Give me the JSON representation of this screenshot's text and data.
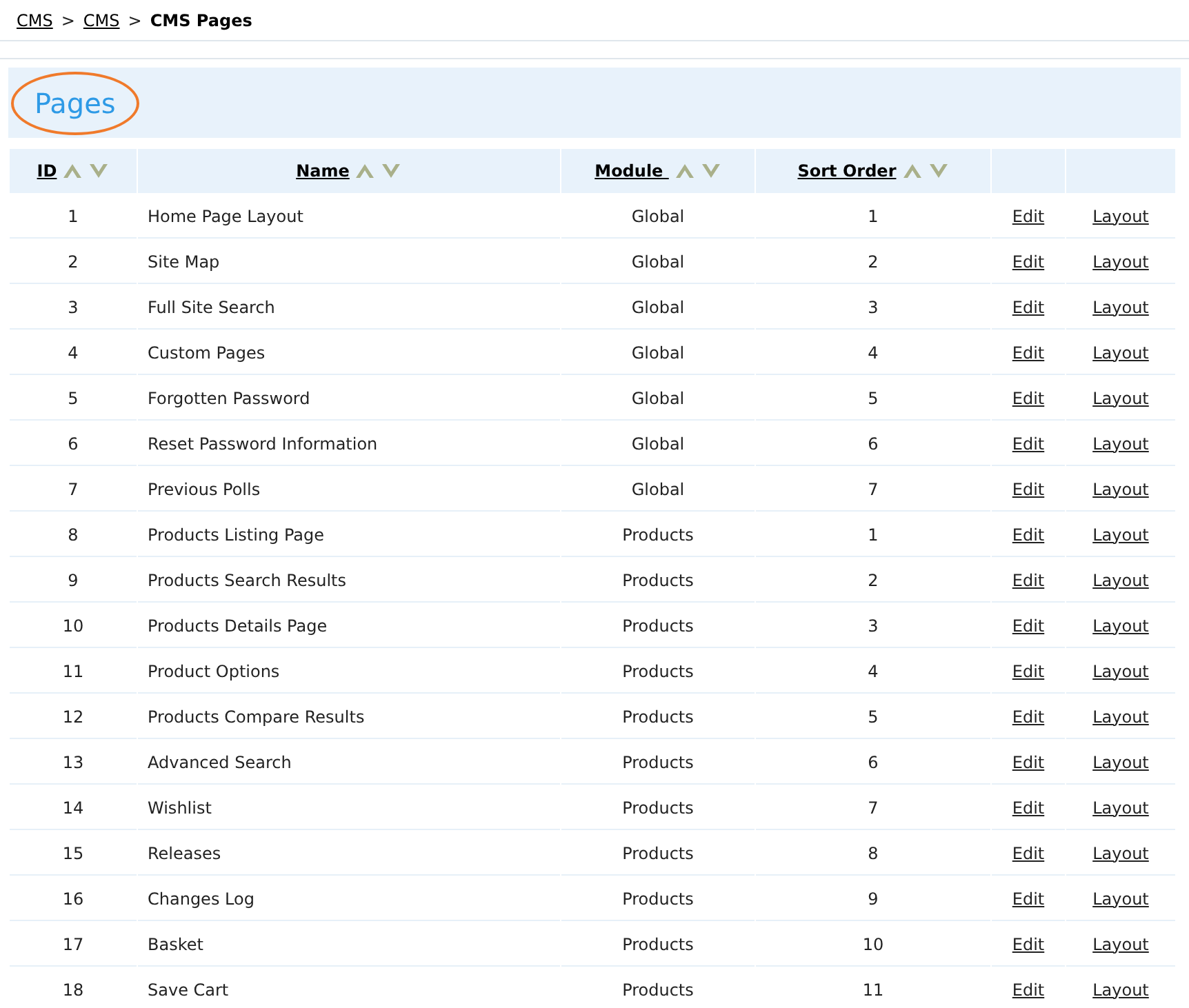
{
  "breadcrumb": {
    "links": [
      "CMS",
      "CMS"
    ],
    "separators": [
      ">",
      ">"
    ],
    "current": "CMS Pages"
  },
  "panel": {
    "title": "Pages",
    "circled": true
  },
  "table": {
    "columns": [
      {
        "label": "ID",
        "sortable": true
      },
      {
        "label": "Name",
        "sortable": true
      },
      {
        "label": "Module ",
        "sortable": true
      },
      {
        "label": "Sort Order",
        "sortable": true
      }
    ],
    "rows": [
      {
        "id": "1",
        "name": "Home Page Layout",
        "module": "Global",
        "sort_order": "1",
        "edit": "Edit",
        "layout": "Layout"
      },
      {
        "id": "2",
        "name": "Site Map",
        "module": "Global",
        "sort_order": "2",
        "edit": "Edit",
        "layout": "Layout"
      },
      {
        "id": "3",
        "name": "Full Site Search",
        "module": "Global",
        "sort_order": "3",
        "edit": "Edit",
        "layout": "Layout"
      },
      {
        "id": "4",
        "name": "Custom Pages",
        "module": "Global",
        "sort_order": "4",
        "edit": "Edit",
        "layout": "Layout"
      },
      {
        "id": "5",
        "name": "Forgotten Password",
        "module": "Global",
        "sort_order": "5",
        "edit": "Edit",
        "layout": "Layout"
      },
      {
        "id": "6",
        "name": "Reset Password Information",
        "module": "Global",
        "sort_order": "6",
        "edit": "Edit",
        "layout": "Layout"
      },
      {
        "id": "7",
        "name": "Previous Polls",
        "module": "Global",
        "sort_order": "7",
        "edit": "Edit",
        "layout": "Layout"
      },
      {
        "id": "8",
        "name": "Products Listing Page",
        "module": "Products",
        "sort_order": "1",
        "edit": "Edit",
        "layout": "Layout"
      },
      {
        "id": "9",
        "name": "Products Search Results",
        "module": "Products",
        "sort_order": "2",
        "edit": "Edit",
        "layout": "Layout"
      },
      {
        "id": "10",
        "name": "Products Details Page",
        "module": "Products",
        "sort_order": "3",
        "edit": "Edit",
        "layout": "Layout"
      },
      {
        "id": "11",
        "name": "Product Options",
        "module": "Products",
        "sort_order": "4",
        "edit": "Edit",
        "layout": "Layout"
      },
      {
        "id": "12",
        "name": "Products Compare Results",
        "module": "Products",
        "sort_order": "5",
        "edit": "Edit",
        "layout": "Layout"
      },
      {
        "id": "13",
        "name": "Advanced Search",
        "module": "Products",
        "sort_order": "6",
        "edit": "Edit",
        "layout": "Layout"
      },
      {
        "id": "14",
        "name": "Wishlist",
        "module": "Products",
        "sort_order": "7",
        "edit": "Edit",
        "layout": "Layout"
      },
      {
        "id": "15",
        "name": "Releases",
        "module": "Products",
        "sort_order": "8",
        "edit": "Edit",
        "layout": "Layout"
      },
      {
        "id": "16",
        "name": "Changes Log",
        "module": "Products",
        "sort_order": "9",
        "edit": "Edit",
        "layout": "Layout"
      },
      {
        "id": "17",
        "name": "Basket",
        "module": "Products",
        "sort_order": "10",
        "edit": "Edit",
        "layout": "Layout"
      },
      {
        "id": "18",
        "name": "Save Cart",
        "module": "Products",
        "sort_order": "11",
        "edit": "Edit",
        "layout": "Layout"
      }
    ]
  }
}
